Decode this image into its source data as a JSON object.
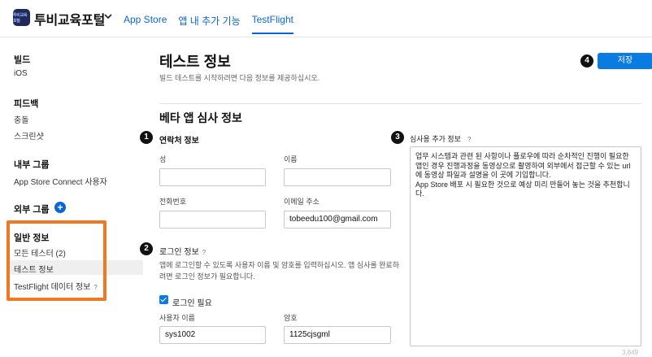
{
  "header": {
    "app_icon_text": "투비교육포털",
    "app_name": "투비교육포털",
    "tabs": [
      "App Store",
      "앱 내 추가 기능",
      "TestFlight"
    ]
  },
  "sidebar": {
    "build_heading": "빌드",
    "build_items": [
      "iOS"
    ],
    "feedback_heading": "피드백",
    "feedback_items": [
      "충돌",
      "스크린샷"
    ],
    "internal_heading": "내부 그룹",
    "internal_items": [
      "App Store Connect 사용자"
    ],
    "external_heading": "외부 그룹",
    "general_heading": "일반 정보",
    "general_items": [
      "모든 테스터 (2)",
      "테스트 정보",
      "TestFlight 데이터 정보"
    ],
    "help_mark": "?"
  },
  "main": {
    "title": "테스트 정보",
    "subtitle": "빌드 테스트를 시작하려면 다음 정보를 제공하십시오.",
    "save_label": "저장",
    "section_title": "베타 앱 심사 정보",
    "contact": {
      "heading": "연락처 정보",
      "last_name_label": "성",
      "first_name_label": "이름",
      "phone_label": "전화번호",
      "email_label": "이메일 주소",
      "last_name_value": "",
      "first_name_value": "",
      "phone_value": "",
      "email_value": "tobeedu100@gmail.com"
    },
    "login": {
      "heading": "로그인 정보",
      "help_mark": "?",
      "description": "앱에 로그인할 수 있도록 사용자 이름 및 암호를 입력하십시오. 앱 심사를 완료하려면 로그인 정보가 필요합니다.",
      "required_label": "로그인 필요",
      "username_label": "사용자 이름",
      "password_label": "암호",
      "username_value": "sys1002",
      "password_value": "1125cjsgml"
    },
    "review": {
      "heading": "심사용 추가 정보",
      "help_mark": "?",
      "notes": "업무 시스템과 관련 된 사항이나 플로우에 따라 순차적인 진행이 필요한 앱인 경우 진행과정을 동영상으로 촬영하여 외부에서 접근할 수 있는 url 에 동영상 파일과 설명을 이 곳에 기입합니다.\nApp Store 배포 시 필요한 것으로 예상 미리 만들어 놓는 것을 추천합니다."
    },
    "char_counter": "3,849"
  },
  "callouts": [
    "1",
    "2",
    "3",
    "4"
  ],
  "colors": {
    "accent": "#0a66d8",
    "highlight": "#f07822"
  }
}
